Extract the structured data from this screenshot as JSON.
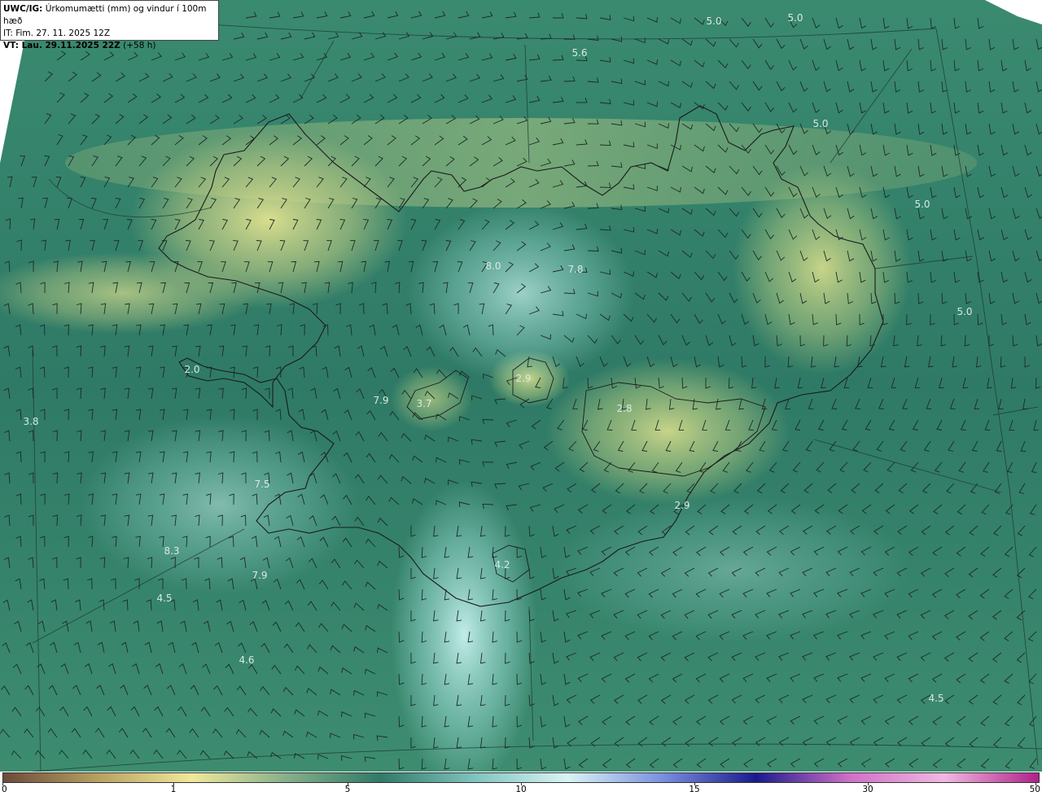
{
  "header": {
    "model": "UWC/IG:",
    "title": "Úrkomumætti (mm) og vindur í 100m hæð",
    "issue_time": "IT: Fim. 27. 11. 2025 12Z",
    "valid_label": "VT: Lau. 29.11.2025 22Z",
    "lead": "(+58 h)"
  },
  "point_values": [
    "5.0",
    "5.0",
    "5.6",
    "5.0",
    "5.0",
    "5.0",
    "8.0",
    "7.8",
    "2.0",
    "7.9",
    "3.7",
    "2.9",
    "2.8",
    "3.8",
    "7.5",
    "2.9",
    "8.3",
    "4.2",
    "7.9",
    "4.5",
    "4.6",
    "4.5"
  ],
  "colorbar": {
    "ticks": [
      "0",
      "1",
      "5",
      "10",
      "15",
      "30",
      "50"
    ],
    "colors": [
      "#6b4a3a",
      "#b8a060",
      "#f0e89a",
      "#86b08a",
      "#2f7a68",
      "#7fc4be",
      "#d8f4f4",
      "#7a90e0",
      "#1a1a8c",
      "#d070c8",
      "#f0b8e0",
      "#b0208a"
    ]
  },
  "colors": {
    "sea": "#2f7a66",
    "land": "#4e9a74",
    "low_precip": "#dde590",
    "high_precip": "#b8ecea"
  }
}
